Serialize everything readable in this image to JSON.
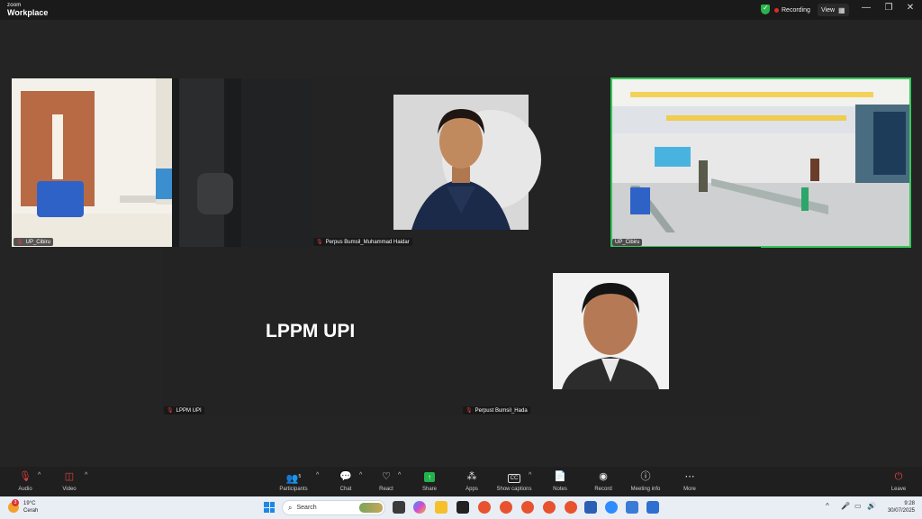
{
  "app": {
    "brand_top": "zoom",
    "brand_bottom": "Workplace",
    "recording": "Recording",
    "view": "View"
  },
  "tiles": {
    "t1_label": "UP_Cibiru",
    "t2_label": "Perpus Bumsil_Muhammad Haidar",
    "t3_label": "UP_Cibiru",
    "t4_label": "LPPM UPI",
    "t4_text": "LPPM UPI",
    "t5_label": "Perpust Bumsil_Hada"
  },
  "toolbar": {
    "audio": "Audio",
    "video": "Video",
    "participants": "Participants",
    "participants_count": "5",
    "chat": "Chat",
    "react": "React",
    "share": "Share",
    "apps": "Apps",
    "captions": "Show captions",
    "notes": "Notes",
    "record": "Record",
    "meeting_info": "Meeting info",
    "more": "More",
    "leave": "Leave"
  },
  "taskbar": {
    "weather_temp": "19°C",
    "weather_desc": "Cerah",
    "weather_badge": "3",
    "search_placeholder": "Search",
    "time": "9:28",
    "date": "30/07/2025"
  },
  "colors": {
    "active_border": "#35c759",
    "mic_off": "#e24040",
    "share_green": "#22b24c"
  }
}
